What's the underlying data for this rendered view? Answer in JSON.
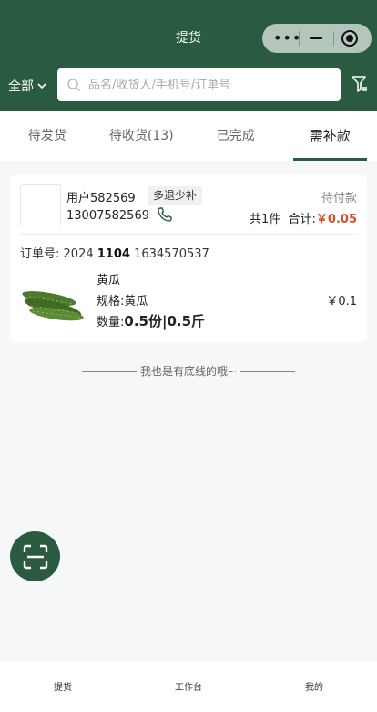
{
  "header": {
    "title": "提货",
    "filter_label": "全部",
    "search_placeholder": "品名/收货人/手机号/订单号"
  },
  "colors": {
    "brand": "#2a5a3f",
    "price": "#d0542b"
  },
  "icons": [
    "more-dots-icon",
    "minimize-icon",
    "target-icon",
    "chevron-down-icon",
    "search-icon",
    "funnel-filter-icon",
    "phone-icon",
    "scan-icon"
  ],
  "tabs": [
    {
      "label": "待发货"
    },
    {
      "label": "待收货(13)"
    },
    {
      "label": "已完成"
    },
    {
      "label": "需补款",
      "active": true
    }
  ],
  "order": {
    "user_name": "用户582569",
    "badge": "多退少补",
    "phone": "13007582569",
    "status": "待付款",
    "count_label": "共1件",
    "total_label": "合计:",
    "total_price": "￥0.05",
    "order_no_label": "订单号:",
    "order_no_part1": "2024",
    "order_no_part2": "1104",
    "order_no_part3": "1634570537",
    "product": {
      "name": "黄瓜",
      "spec_label": "规格:",
      "spec": "黄瓜",
      "qty_label": "数量:",
      "qty": "0.5份|0.5斤",
      "price": "￥0.1"
    }
  },
  "footer_text": "我也是有底线的哦~",
  "tabbar": [
    {
      "label": "提货"
    },
    {
      "label": "工作台"
    },
    {
      "label": "我的"
    }
  ]
}
